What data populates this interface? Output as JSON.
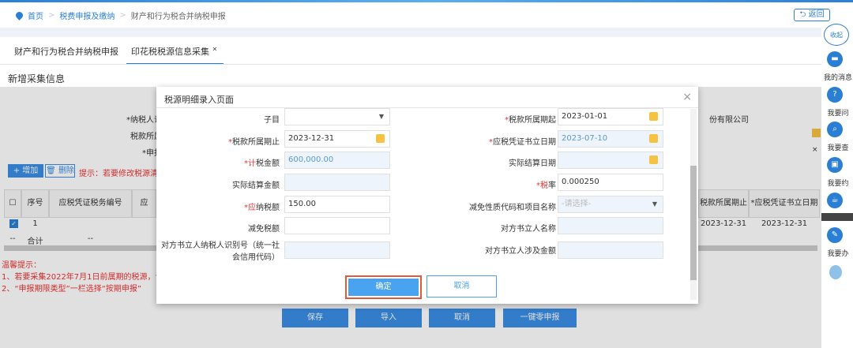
{
  "breadcrumb": {
    "home": "首页",
    "level2": "税费申报及缴纳",
    "current": "财产和行为税合并纳税申报"
  },
  "back_label": "返回",
  "tabs": [
    {
      "label": "财产和行为税合并纳税申报"
    },
    {
      "label": "印花税税源信息采集",
      "close": "×"
    }
  ],
  "section_title": "新增采集信息",
  "form_bg": {
    "taxpayer_id": "*纳税人识别号",
    "period_start": "税款所属期起",
    "declare_type": "*申报属性",
    "company": "份有限公司",
    "clear_mark": "×"
  },
  "toolbar": {
    "add": "+ 增加",
    "delete": "删除",
    "tip": "提示：若要修改税源清"
  },
  "table": {
    "headers": [
      "序号",
      "应税凭证税务编号",
      "应",
      "税款所属期止",
      "*应税凭证书立日期"
    ],
    "row": {
      "index": "1",
      "period_end": "2023-12-31",
      "sign_date": "2023-12-31"
    },
    "total": {
      "mark": "--",
      "label": "合计",
      "dash": "--"
    }
  },
  "hints": {
    "title": "温馨提示：",
    "line1": "1、若要采集2022年7月1日前属期的税源，请",
    "line2": "2、“申报期限类型”一栏选择“按期申报”"
  },
  "bottom_buttons": {
    "save": "保存",
    "import": "导入",
    "cancel": "取消",
    "zero": "一键零申报"
  },
  "modal": {
    "title": "税源明细录入页面",
    "close": "×",
    "left": [
      {
        "label": "子目",
        "value": "",
        "type": "select"
      },
      {
        "label": "*税款所属期止",
        "value": "2023-12-31",
        "type": "date"
      },
      {
        "label": "*计税金额",
        "value": "600,000.00",
        "type": "readonly"
      },
      {
        "label": "实际结算金额",
        "value": "",
        "type": "readonly"
      },
      {
        "label": "*应纳税额",
        "value": "150.00",
        "type": "text"
      },
      {
        "label": "减免税额",
        "value": "",
        "type": "text"
      },
      {
        "label": "对方书立人纳税人识别号（统一社会信用代码）",
        "value": "",
        "type": "readonly"
      }
    ],
    "right": [
      {
        "label": "*税款所属期起",
        "value": "2023-01-01",
        "type": "date"
      },
      {
        "label": "*应税凭证书立日期",
        "value": "2023-07-10",
        "type": "date-readonly"
      },
      {
        "label": "实际结算日期",
        "value": "",
        "type": "date-readonly"
      },
      {
        "label": "*税率",
        "value": "0.000250",
        "type": "text"
      },
      {
        "label": "减免性质代码和项目名称",
        "placeholder": "-请选择-",
        "type": "select"
      },
      {
        "label": "对方书立人名称",
        "value": "",
        "type": "readonly"
      },
      {
        "label": "对方书立人涉及金额",
        "value": "",
        "type": "readonly"
      }
    ],
    "confirm": "确定",
    "cancel": "取消"
  },
  "sidebar": {
    "collapse": "收起",
    "items": [
      {
        "label": "我的消息",
        "icon": "message-icon"
      },
      {
        "label": "我要问",
        "icon": "question-icon"
      },
      {
        "label": "我要查",
        "icon": "search-icon"
      },
      {
        "label": "我要约",
        "icon": "calendar-icon"
      },
      {
        "label": "我要办",
        "icon": "edit-icon"
      }
    ]
  },
  "colors": {
    "primary": "#2a7fd4",
    "button": "#3a8ee6",
    "highlight": "#e0593a",
    "required": "#e33333"
  }
}
